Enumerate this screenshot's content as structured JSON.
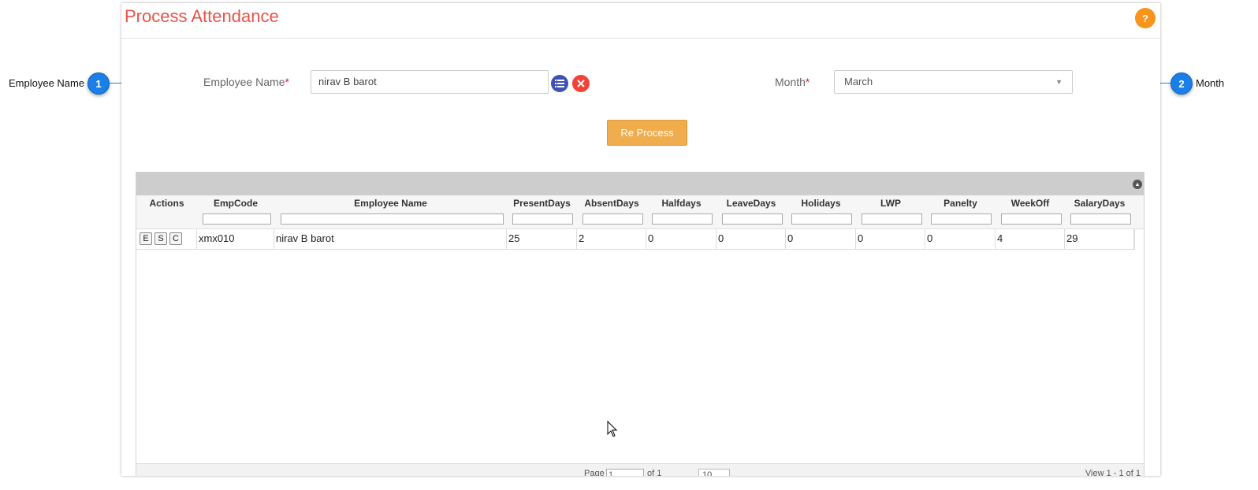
{
  "callouts": [
    {
      "number": "1",
      "label": "Employee Name"
    },
    {
      "number": "2",
      "label": "Month"
    }
  ],
  "panel": {
    "title": "Process Attendance",
    "help_label": "?"
  },
  "form": {
    "employee_label": "Employee Name",
    "employee_required": "*",
    "employee_value": "nirav B barot",
    "month_label": "Month",
    "month_required": "*",
    "month_value": "March",
    "reprocess_label": "Re Process"
  },
  "grid": {
    "columns": [
      "Actions",
      "EmpCode",
      "Employee Name",
      "PresentDays",
      "AbsentDays",
      "Halfdays",
      "LeaveDays",
      "Holidays",
      "LWP",
      "Panelty",
      "WeekOff",
      "SalaryDays"
    ],
    "rows": [
      {
        "actions": [
          "E",
          "S",
          "C"
        ],
        "cells": [
          "xmx010",
          "nirav B barot",
          "25",
          "2",
          "0",
          "0",
          "0",
          "0",
          "0",
          "4",
          "29"
        ]
      }
    ],
    "pager": {
      "page_label": "Page",
      "page_value": "1",
      "of_label": "of 1",
      "rows_per_page": "10",
      "view_text": "View 1 - 1 of 1"
    }
  },
  "colors": {
    "title": "#e8534a",
    "accent": "#1a7fe6",
    "button": "#f0ad4e",
    "help": "#f7941d",
    "grid_btn": "#3f51b5",
    "clear_btn": "#f44336"
  },
  "icons": [
    "list-icon",
    "close-icon",
    "chevron-down-icon",
    "collapse-icon",
    "cursor-icon"
  ]
}
